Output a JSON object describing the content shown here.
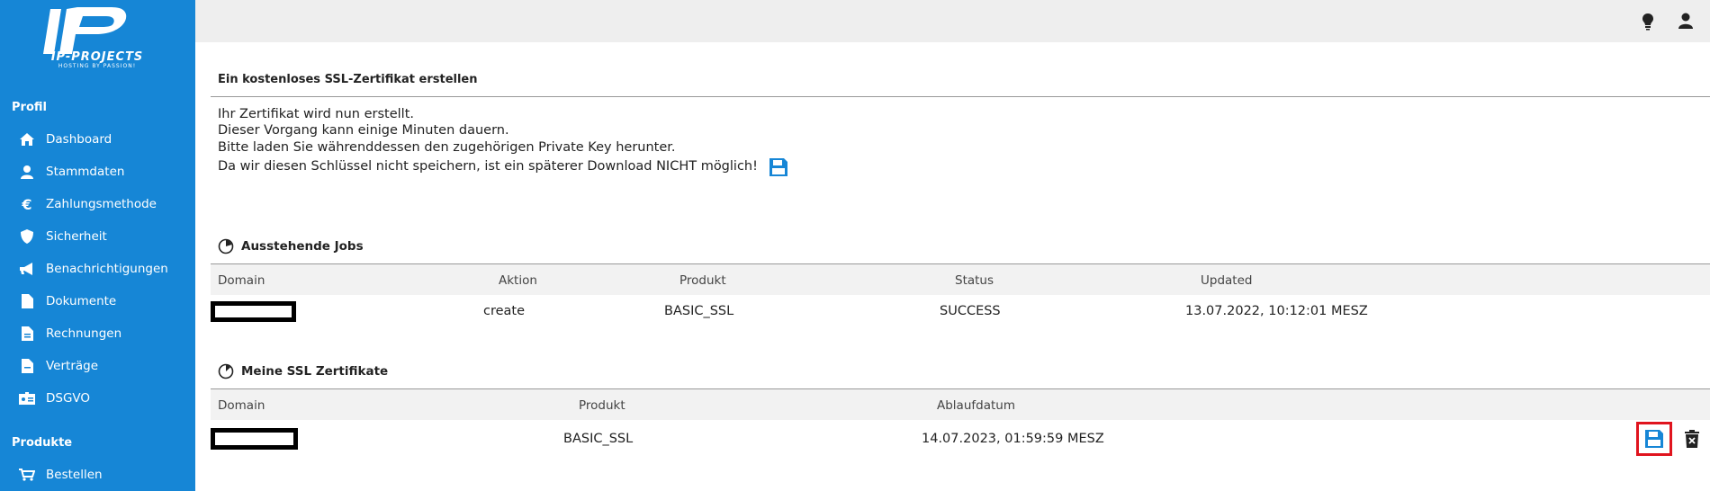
{
  "brand": {
    "name": "IP-PROJECTS",
    "tagline": "HOSTING BY PASSION!"
  },
  "sidebar": {
    "sections": [
      {
        "label": "Profil"
      },
      {
        "label": "Produkte"
      }
    ],
    "items": [
      {
        "label": "Dashboard",
        "icon": "home-icon"
      },
      {
        "label": "Stammdaten",
        "icon": "user-icon"
      },
      {
        "label": "Zahlungsmethode",
        "icon": "euro-icon"
      },
      {
        "label": "Sicherheit",
        "icon": "shield-icon"
      },
      {
        "label": "Benachrichtigungen",
        "icon": "megaphone-icon"
      },
      {
        "label": "Dokumente",
        "icon": "document-icon"
      },
      {
        "label": "Rechnungen",
        "icon": "invoice-icon"
      },
      {
        "label": "Verträge",
        "icon": "contract-icon"
      },
      {
        "label": "DSGVO",
        "icon": "id-card-icon"
      },
      {
        "label": "Bestellen",
        "icon": "cart-icon"
      }
    ]
  },
  "topbar": {
    "icons": [
      "lightbulb-icon",
      "user-icon"
    ]
  },
  "main": {
    "title": "Ein kostenloses SSL-Zertifikat erstellen",
    "messages": [
      "Ihr Zertifikat wird nun erstellt.",
      "Dieser Vorgang kann einige Minuten dauern.",
      "Bitte laden Sie währenddessen den zugehörigen Private Key herunter.",
      "Da wir diesen Schlüssel nicht speichern, ist ein späterer Download NICHT möglich!"
    ]
  },
  "jobs": {
    "title": "Ausstehende Jobs",
    "columns": [
      "Domain",
      "Aktion",
      "Produkt",
      "Status",
      "Updated"
    ],
    "rows": [
      {
        "domain": "",
        "aktion": "create",
        "produkt": "BASIC_SSL",
        "status": "SUCCESS",
        "updated": "13.07.2022, 10:12:01 MESZ"
      }
    ]
  },
  "certs": {
    "title": "Meine SSL Zertifikate",
    "columns": [
      "Domain",
      "Produkt",
      "Ablaufdatum"
    ],
    "rows": [
      {
        "domain": "",
        "produkt": "BASIC_SSL",
        "ablaufdatum": "14.07.2023, 01:59:59 MESZ"
      }
    ]
  },
  "colors": {
    "sidebar": "#1686d6",
    "accent": "#1686d6",
    "highlight": "#e0141e"
  }
}
